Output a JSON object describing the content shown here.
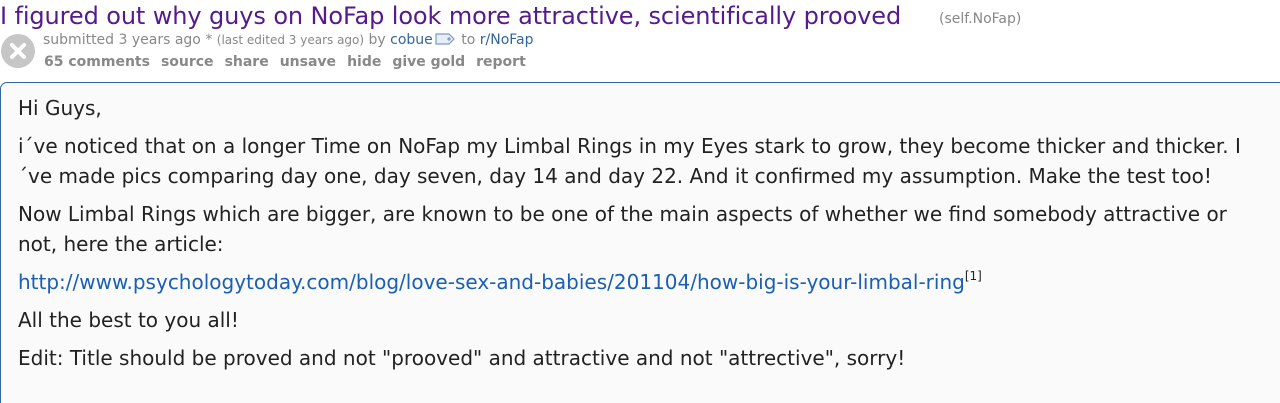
{
  "post": {
    "title": "I figured out why guys on NoFap look more attractive, scientifically prooved",
    "domain": "(self.NoFap)"
  },
  "tagline": {
    "submitted": "submitted 3 years ago * ",
    "edited": "(last edited 3 years ago)",
    "by": " by ",
    "author": "cobue",
    "to": " to ",
    "subreddit": "r/NoFap"
  },
  "buttons": {
    "comments": "65 comments",
    "source": "source",
    "share": "share",
    "unsave": "unsave",
    "hide": "hide",
    "give_gold": "give gold",
    "report": "report"
  },
  "body": {
    "p1": "Hi Guys,",
    "p2": "i´ve noticed that on a longer Time on NoFap my Limbal Rings in my Eyes stark to grow, they become thicker and thicker. I´ve made pics comparing day one, day seven, day 14 and day 22. And it confirmed my assumption. Make the test too!",
    "p3": "Now Limbal Rings which are bigger, are known to be one of the main aspects of whether we find somebody attractive or not, here the article:",
    "link": "http://www.psychologytoday.com/blog/love-sex-and-babies/201104/how-big-is-your-limbal-ring",
    "link_ref": "[1]",
    "p4": "All the best to you all!",
    "p5": "Edit: Title should be proved and not \"prooved\" and attractive and not \"attrective\", sorry!"
  },
  "icons": {
    "hide": "close-icon",
    "flair": "tag-icon"
  },
  "colors": {
    "title_visited": "#551a8b",
    "link": "#336699",
    "meta": "#888888",
    "box_border": "#336699"
  }
}
